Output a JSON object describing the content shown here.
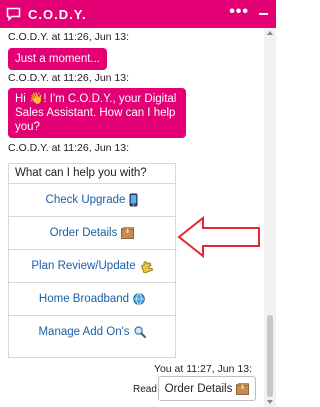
{
  "header": {
    "title": "C.O.D.Y.",
    "menu_label": "•••",
    "bg_color": "#e20074"
  },
  "messages": [
    {
      "sender": "C.O.D.Y. at 11:26, Jun 13:",
      "text": "Just a moment..."
    },
    {
      "sender": "C.O.D.Y. at 11:26, Jun 13:",
      "text": "Hi 👋! I'm C.O.D.Y., your Digital Sales Assistant. How can I help you?"
    },
    {
      "sender": "C.O.D.Y. at 11:26, Jun 13:"
    }
  ],
  "options": {
    "prompt": "What can I help you with?",
    "items": [
      {
        "label": "Check Upgrade",
        "icon": "phone-icon"
      },
      {
        "label": "Order Details",
        "icon": "package-icon"
      },
      {
        "label": "Plan Review/Update",
        "icon": "puzzle-icon"
      },
      {
        "label": "Home Broadband",
        "icon": "globe-icon"
      },
      {
        "label": "Manage Add On's",
        "icon": "magnifier-icon"
      }
    ]
  },
  "user_reply": {
    "timestamp": "You at 11:27, Jun 13:",
    "status": "Read",
    "text": "Order Details",
    "icon": "package-icon"
  },
  "annotation": {
    "color": "#e8262a",
    "icon": "arrow-left-icon"
  }
}
